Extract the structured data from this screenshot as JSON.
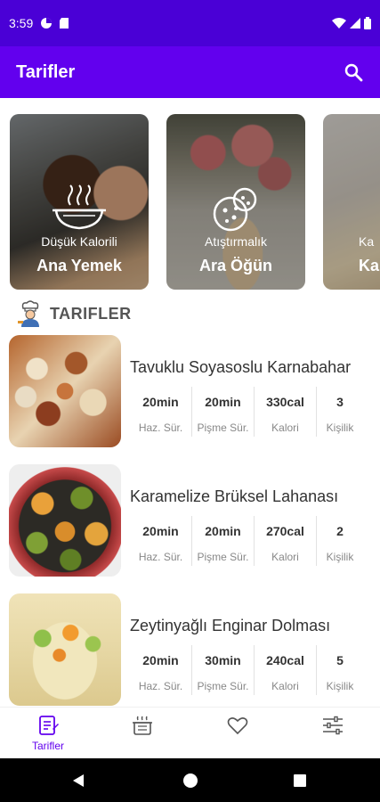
{
  "status_bar": {
    "time": "3:59"
  },
  "app_bar": {
    "title": "Tarifler"
  },
  "categories": [
    {
      "subtitle": "Düşük Kalorili",
      "title": "Ana Yemek"
    },
    {
      "subtitle": "Atıştırmalık",
      "title": "Ara Öğün"
    },
    {
      "subtitle": "Ka",
      "title": "Ka"
    }
  ],
  "section": {
    "label": "TARIFLER"
  },
  "stat_labels": {
    "prep": "Haz. Sür.",
    "cook": "Pişme Sür.",
    "cal": "Kalori",
    "serv": "Kişilik"
  },
  "recipes": [
    {
      "name": "Tavuklu Soyasoslu Karnabahar",
      "prep": "20min",
      "cook": "20min",
      "cal": "330cal",
      "serv": "3"
    },
    {
      "name": "Karamelize Brüksel Lahanası",
      "prep": "20min",
      "cook": "20min",
      "cal": "270cal",
      "serv": "2"
    },
    {
      "name": "Zeytinyağlı Enginar Dolması",
      "prep": "20min",
      "cook": "30min",
      "cal": "240cal",
      "serv": "5"
    }
  ],
  "bottom_nav": {
    "tab_recipes": "Tarifler"
  },
  "colors": {
    "primary": "#6200ee",
    "status": "#4a00d6"
  }
}
